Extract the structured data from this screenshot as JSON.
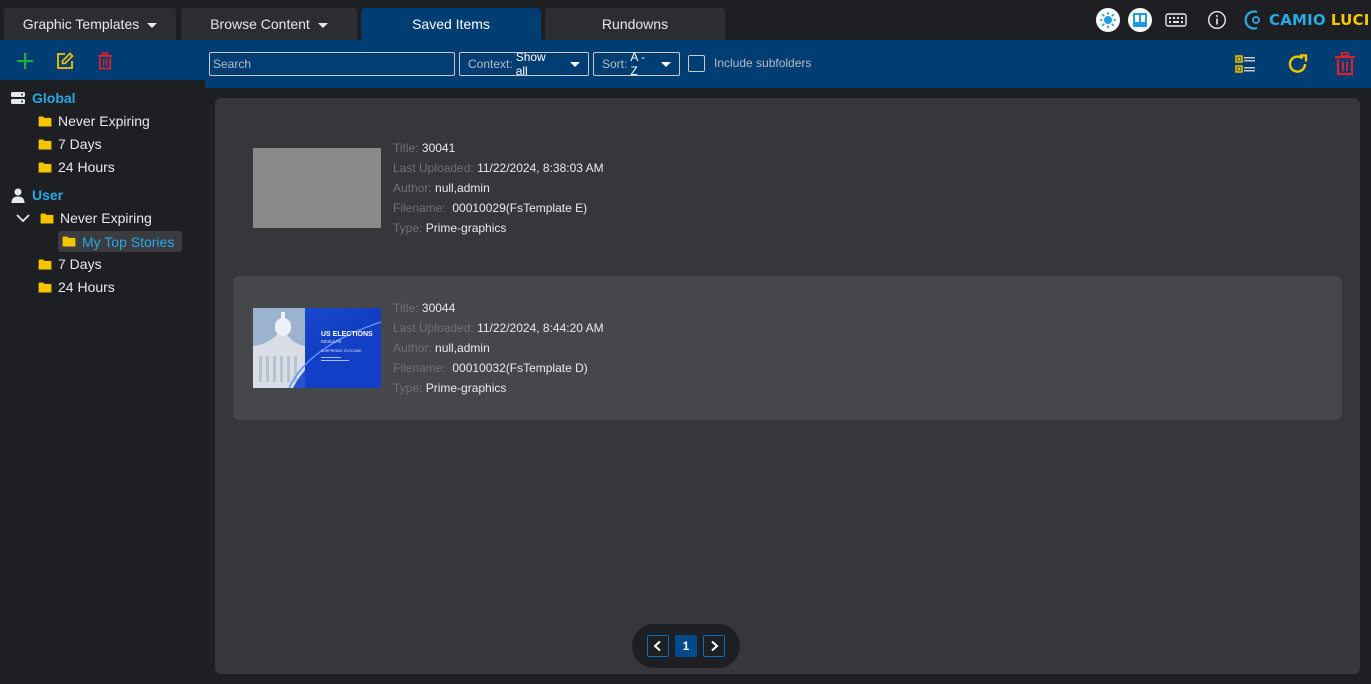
{
  "tabs": [
    {
      "label": "Graphic Templates",
      "active": false,
      "has_dropdown": true
    },
    {
      "label": "Browse Content",
      "active": false,
      "has_dropdown": true
    },
    {
      "label": "Saved Items",
      "active": true,
      "has_dropdown": false
    },
    {
      "label": "Rundowns",
      "active": false,
      "has_dropdown": false
    }
  ],
  "header_icons": [
    "sun-icon",
    "layout-icon",
    "keyboard-icon",
    "info-icon"
  ],
  "brand": {
    "part1": "CAMIO",
    "part2": "LUCI",
    "colors": {
      "part1": "#29a9e6",
      "part2": "#f5c400"
    }
  },
  "sidebar": {
    "tools": [
      "add-icon",
      "edit-icon",
      "trash-icon"
    ],
    "groups": [
      {
        "label": "Global",
        "icon": "server-icon",
        "items": [
          {
            "label": "Never Expiring"
          },
          {
            "label": "7 Days"
          },
          {
            "label": "24 Hours"
          }
        ]
      },
      {
        "label": "User",
        "icon": "user-icon",
        "items": [
          {
            "label": "Never Expiring",
            "expanded": true,
            "children": [
              {
                "label": "My Top Stories",
                "selected": true
              }
            ]
          },
          {
            "label": "7 Days"
          },
          {
            "label": "24 Hours"
          }
        ]
      }
    ]
  },
  "filters": {
    "search_placeholder": "Search",
    "context_label": "Context:",
    "context_value": "Show all",
    "sort_label": "Sort:",
    "sort_value": "A - Z",
    "include_subfolders_label": "Include subfolders",
    "include_subfolders_checked": false
  },
  "labels": {
    "title": "Title:",
    "last_uploaded": "Last Uploaded:",
    "author": "Author:",
    "filename": "Filename:",
    "type": "Type:"
  },
  "items": [
    {
      "title": "30041",
      "last_uploaded": "11/22/2024, 8:38:03 AM",
      "author": "null,admin",
      "filename": "00010029(FsTemplate E)",
      "type": "Prime-graphics",
      "thumbnail": "gray-placeholder"
    },
    {
      "title": "30044",
      "last_uploaded": "11/22/2024, 8:44:20 AM",
      "author": "null,admin",
      "filename": "00010032(FsTemplate D)",
      "type": "Prime-graphics",
      "thumbnail": "us-elections-graphic",
      "hovered": true,
      "thumb_text": {
        "headline": "US ELECTIONS",
        "sub": "RESULTS",
        "line3": "SURPRISING OUTCOME"
      }
    }
  ],
  "pagination": {
    "current_page": "1"
  },
  "colors": {
    "accent_blue": "#003d73",
    "link_blue": "#29a9e6",
    "folder_yellow": "#f5c400",
    "delete_red": "#e0202a",
    "add_green": "#1fae3c"
  }
}
